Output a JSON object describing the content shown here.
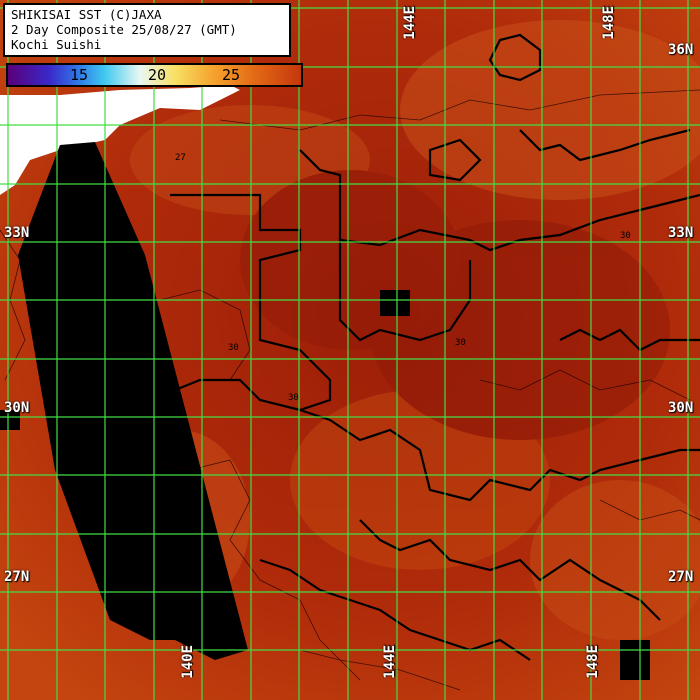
{
  "header": {
    "line1": "SHIKISAI SST (C)JAXA",
    "line2": "2 Day Composite 25/08/27 (GMT)",
    "line3": "Kochi Suishi"
  },
  "colorbar": {
    "ticks": [
      "15",
      "20",
      "25"
    ]
  },
  "grid": {
    "lat_labels": {
      "n36": "36N",
      "n33": "33N",
      "n30": "30N",
      "n27": "27N"
    },
    "lon_labels": {
      "e140": "140E",
      "e144": "144E",
      "e148": "148E"
    }
  },
  "contour_labels": [
    "27",
    "30",
    "30",
    "30",
    "30"
  ],
  "colors": {
    "sea_warm": "#b8300a",
    "sea_hot": "#a1200a",
    "land_cloud": "#ffffff",
    "swath_gap": "#000000",
    "grid": "#44dd44",
    "contour": "#000000"
  }
}
